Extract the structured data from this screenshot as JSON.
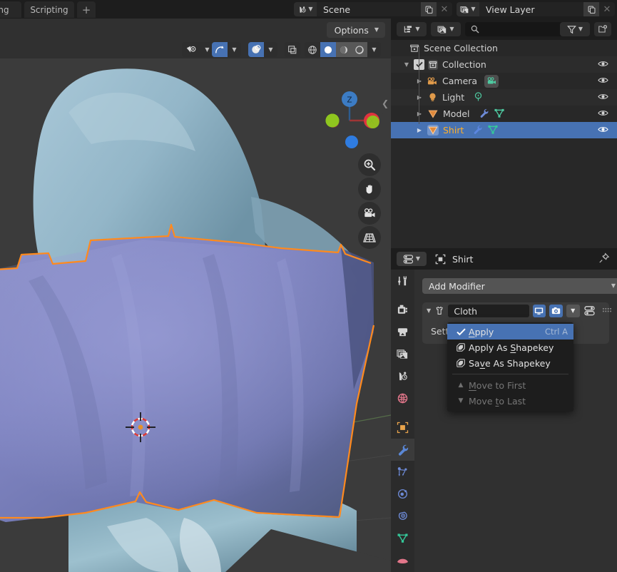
{
  "app": "Blender",
  "topbar": {
    "tabs": [
      {
        "label": "ting",
        "name": "tab-texture-paint-cut"
      },
      {
        "label": "Scripting",
        "name": "tab-scripting"
      },
      {
        "label": "+",
        "name": "tab-add"
      }
    ],
    "scene": {
      "icon": "scene-icon",
      "value": "Scene",
      "new_icon": "duplicate-icon",
      "unlink_icon": "close-icon"
    },
    "view_layer": {
      "icon": "view-layer-icon",
      "value": "View Layer",
      "new_icon": "duplicate-icon",
      "remove_icon": "close-icon"
    }
  },
  "viewport": {
    "options_label": "Options",
    "options_chevron": "chevron-down-icon",
    "visibility_icon": "object-visibility-icon",
    "snap_icon": "snap-magnet-icon",
    "proportional_icon": "proportional-edit-icon",
    "overlays_toggle_icon": "overlays-icon",
    "xray_icon": "xray-toggle-icon",
    "shading": [
      {
        "name": "shading-wireframe",
        "icon": "wireframe-icon",
        "active": false
      },
      {
        "name": "shading-solid",
        "icon": "solid-sphere-icon",
        "active": true
      },
      {
        "name": "shading-material",
        "icon": "material-preview-icon",
        "active": false
      },
      {
        "name": "shading-rendered",
        "icon": "rendered-icon",
        "active": false
      }
    ],
    "gizmo": {
      "axis_z": "Z",
      "axis_x": "X"
    },
    "nav_buttons": [
      {
        "name": "zoom-button",
        "icon": "magnifier-plus-icon"
      },
      {
        "name": "pan-button",
        "icon": "hand-icon"
      },
      {
        "name": "camera-view-button",
        "icon": "camera-icon"
      },
      {
        "name": "toggle-ortho-button",
        "icon": "grid-perspective-icon"
      }
    ],
    "collapse_icon": "chevron-left-icon",
    "cursor": "3d-cursor",
    "colors": {
      "background": "#3b3b3b",
      "body": "#9cbccd",
      "cloth": "#8186c1",
      "selection_outline": "#ff8a1e"
    }
  },
  "outliner": {
    "display_mode_icon": "outliner-display-mode-icon",
    "filter_id_icon": "id-type-filter-icon",
    "search_icon": "search-icon",
    "search_value": "",
    "filter_icon": "filter-funnel-icon",
    "new_collection_icon": "new-collection-icon",
    "rows": [
      {
        "label": "Scene Collection",
        "icon": "scene-collection-icon",
        "indent": 0,
        "disclosure": "",
        "checkbox": false,
        "selected": false,
        "eye": false,
        "extras": []
      },
      {
        "label": "Collection",
        "icon": "collection-icon",
        "indent": 1,
        "disclosure": "down",
        "checkbox": true,
        "selected": false,
        "eye": true,
        "extras": []
      },
      {
        "label": "Camera",
        "icon": "camera-object-icon",
        "indent": 2,
        "disclosure": "right",
        "checkbox": false,
        "selected": false,
        "eye": true,
        "extras": [
          {
            "name": "camera-data-icon",
            "color": "#4ec9a0",
            "boxed": true
          }
        ]
      },
      {
        "label": "Light",
        "icon": "light-object-icon",
        "indent": 2,
        "disclosure": "right",
        "checkbox": false,
        "selected": false,
        "eye": true,
        "extras": [
          {
            "name": "light-data-icon",
            "color": "#4ec9a0",
            "boxed": false
          }
        ]
      },
      {
        "label": "Model",
        "icon": "mesh-object-icon",
        "indent": 2,
        "disclosure": "right",
        "checkbox": false,
        "selected": false,
        "eye": true,
        "extras": [
          {
            "name": "modifier-wrench-icon",
            "color": "#6d8ad6",
            "boxed": false
          },
          {
            "name": "mesh-data-icon",
            "color": "#4ec9a0",
            "boxed": false
          }
        ]
      },
      {
        "label": "Shirt",
        "icon": "mesh-object-icon",
        "indent": 2,
        "disclosure": "right",
        "checkbox": false,
        "selected": true,
        "eye": true,
        "extras": [
          {
            "name": "modifier-wrench-icon",
            "color": "#6d8ad6",
            "boxed": false
          },
          {
            "name": "mesh-data-icon",
            "color": "#4ec9a0",
            "boxed": false
          }
        ]
      }
    ]
  },
  "properties": {
    "editor_type_icon": "properties-editor-icon",
    "breadcrumb_icon": "object-icon",
    "breadcrumb": "Shirt",
    "pin_icon": "pin-icon",
    "tabs": [
      {
        "name": "tab-tool",
        "icon": "tool-icon",
        "active": false,
        "color": "#d4d4d4"
      },
      {
        "name": "tab-render",
        "icon": "render-camera-icon",
        "active": false,
        "color": "#d4d4d4"
      },
      {
        "name": "tab-output",
        "icon": "printer-output-icon",
        "active": false,
        "color": "#d4d4d4"
      },
      {
        "name": "tab-view-layer",
        "icon": "view-layer-images-icon",
        "active": false,
        "color": "#d4d4d4"
      },
      {
        "name": "tab-scene",
        "icon": "scene-cone-icon",
        "active": false,
        "color": "#d4d4d4"
      },
      {
        "name": "tab-world",
        "icon": "world-globe-icon",
        "active": false,
        "color": "#e2768a"
      },
      {
        "name": "tab-object",
        "icon": "object-square-icon",
        "active": false,
        "color": "#e9a44c"
      },
      {
        "name": "tab-modifiers",
        "icon": "wrench-icon",
        "active": true,
        "color": "#5a87d6"
      },
      {
        "name": "tab-particles",
        "icon": "particles-icon",
        "active": false,
        "color": "#6d8ad6"
      },
      {
        "name": "tab-physics",
        "icon": "physics-orbit-icon",
        "active": false,
        "color": "#6d8ad6"
      },
      {
        "name": "tab-constraints",
        "icon": "constraints-icon",
        "active": false,
        "color": "#6d8ad6"
      },
      {
        "name": "tab-object-data",
        "icon": "mesh-data-triangle-icon",
        "active": false,
        "color": "#4ec9a0"
      },
      {
        "name": "tab-material",
        "icon": "material-sphere-icon",
        "active": false,
        "color": "#e2768a"
      }
    ],
    "add_modifier_label": "Add Modifier",
    "add_modifier_chevron": "chevron-down-icon",
    "modifier": {
      "expand_icon": "triangle-down-icon",
      "type_icon": "cloth-modifier-icon",
      "name": "Cloth",
      "toggles": [
        {
          "name": "realtime-display-toggle",
          "icon": "monitor-icon",
          "active": true
        },
        {
          "name": "render-display-toggle",
          "icon": "camera-render-icon",
          "active": true
        },
        {
          "name": "modifier-extras-dropdown",
          "icon": "chevron-down-icon",
          "active": false
        }
      ],
      "panel_icon": "modifier-panel-icon",
      "drag_handle_icon": "drag-dots-icon",
      "settings_label": "Settin"
    }
  },
  "context_menu": {
    "items": [
      {
        "label": "Apply",
        "shortcut": "Ctrl A",
        "icon": "checkmark-icon",
        "highlighted": true,
        "disabled": false,
        "underline_index": 0
      },
      {
        "label": "Apply As Shapekey",
        "shortcut": "",
        "icon": "shapekey-icon",
        "highlighted": false,
        "disabled": false,
        "underline_index": 9
      },
      {
        "label": "Save As Shapekey",
        "shortcut": "",
        "icon": "shapekey-icon",
        "highlighted": false,
        "disabled": false,
        "underline_index": 2
      },
      {
        "separator": true
      },
      {
        "label": "Move to First",
        "shortcut": "",
        "icon": "triangle-up-icon",
        "highlighted": false,
        "disabled": true,
        "underline_index": 0
      },
      {
        "label": "Move to Last",
        "shortcut": "",
        "icon": "triangle-down-icon",
        "highlighted": false,
        "disabled": true,
        "underline_index": 7
      }
    ]
  }
}
